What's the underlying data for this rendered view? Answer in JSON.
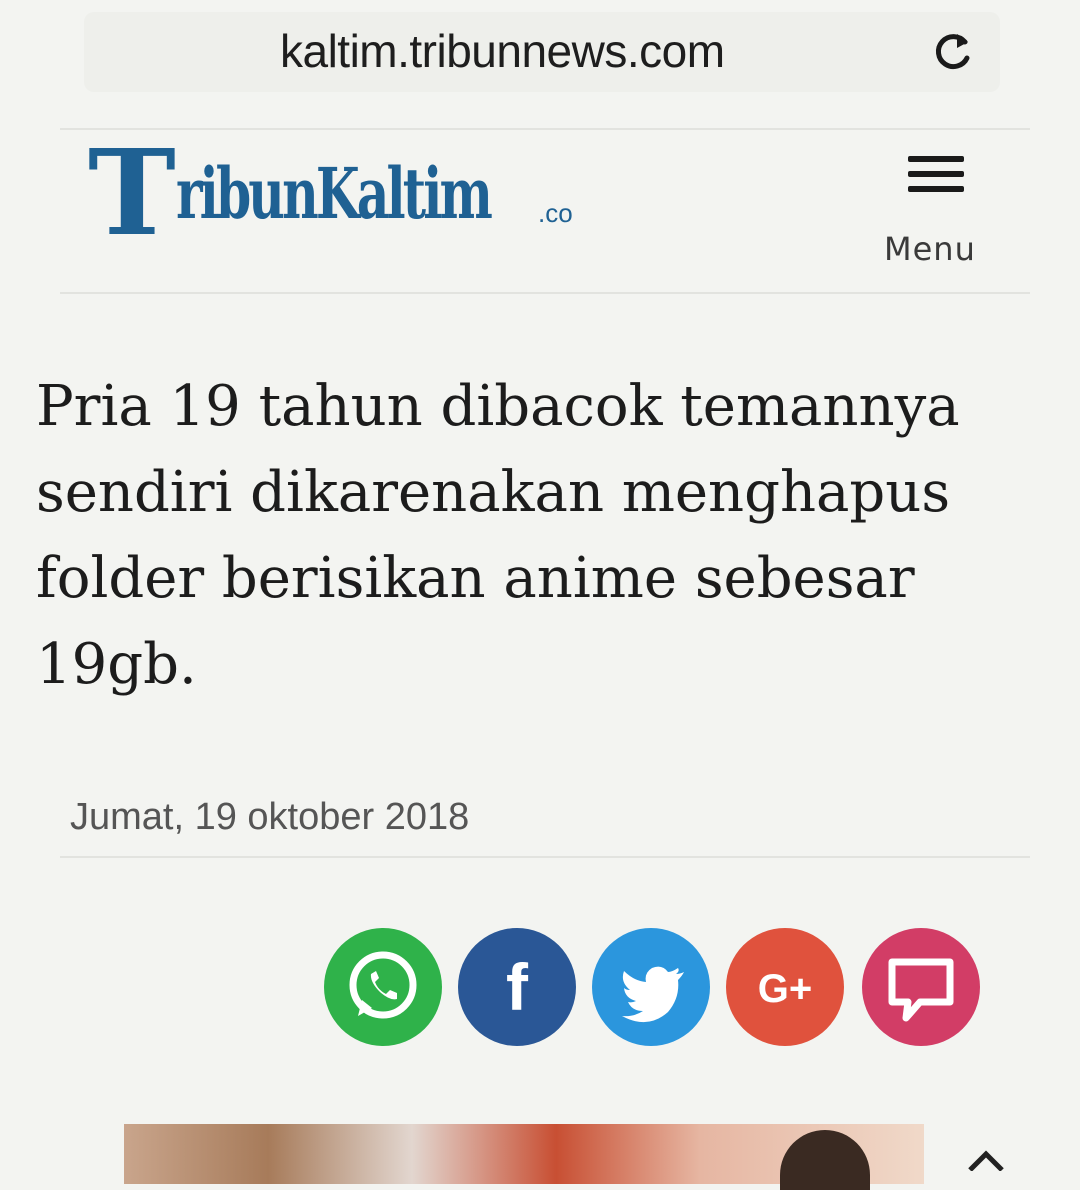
{
  "browser": {
    "url": "kaltim.tribunnews.com",
    "reload_icon": "reload-icon"
  },
  "header": {
    "logo_text": {
      "big_letter": "T",
      "rest": "ribunKaltim",
      "suffix": ".co"
    },
    "logo_color": "#1f6193",
    "menu_label": "Menu",
    "menu_icon": "hamburger-icon"
  },
  "article": {
    "headline": "Pria 19 tahun dibacok temannya sendiri dikarenakan menghapus folder berisikan anime sebesar 19gb.",
    "date": "Jumat, 19 oktober 2018"
  },
  "share": [
    {
      "name": "whatsapp",
      "icon": "whatsapp-icon",
      "color": "#2fb24a"
    },
    {
      "name": "facebook",
      "icon": "facebook-icon",
      "label": "f",
      "color": "#2a5796"
    },
    {
      "name": "twitter",
      "icon": "twitter-bird-icon",
      "color": "#2b96dd"
    },
    {
      "name": "google-plus",
      "icon": "google-plus-icon",
      "label": "G+",
      "color": "#e0523d"
    },
    {
      "name": "comment",
      "icon": "comment-icon",
      "color": "#d23d66"
    }
  ]
}
